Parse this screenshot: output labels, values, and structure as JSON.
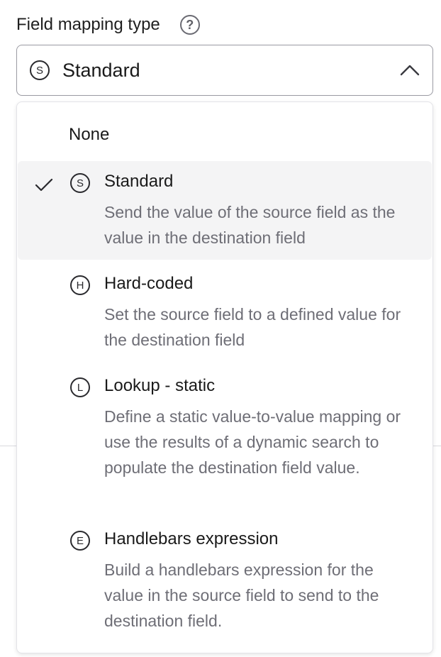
{
  "field": {
    "label": "Field mapping type",
    "help_icon": "question-circle-icon",
    "selected_value": "Standard",
    "selected_badge": "S"
  },
  "dropdown": {
    "options": [
      {
        "label": "None",
        "badge": "",
        "description": "",
        "selected": false
      },
      {
        "label": "Standard",
        "badge": "S",
        "description": "Send the value of the source field as the value in the destination field",
        "selected": true
      },
      {
        "label": "Hard-coded",
        "badge": "H",
        "description": "Set the source field to a defined value for the destination field",
        "selected": false
      },
      {
        "label": "Lookup - static",
        "badge": "L",
        "description": "Define a static value-to-value mapping or use the results of a dynamic search to populate the destination field value.",
        "selected": false
      },
      {
        "label": "Handlebars expression",
        "badge": "E",
        "description": "Build a handlebars expression for the value in the source field to send to the destination field.",
        "selected": false
      }
    ]
  },
  "colors": {
    "selected_row_bg": "#f4f4f5",
    "description_text": "#6e6e76",
    "border": "#9a9aa2"
  }
}
